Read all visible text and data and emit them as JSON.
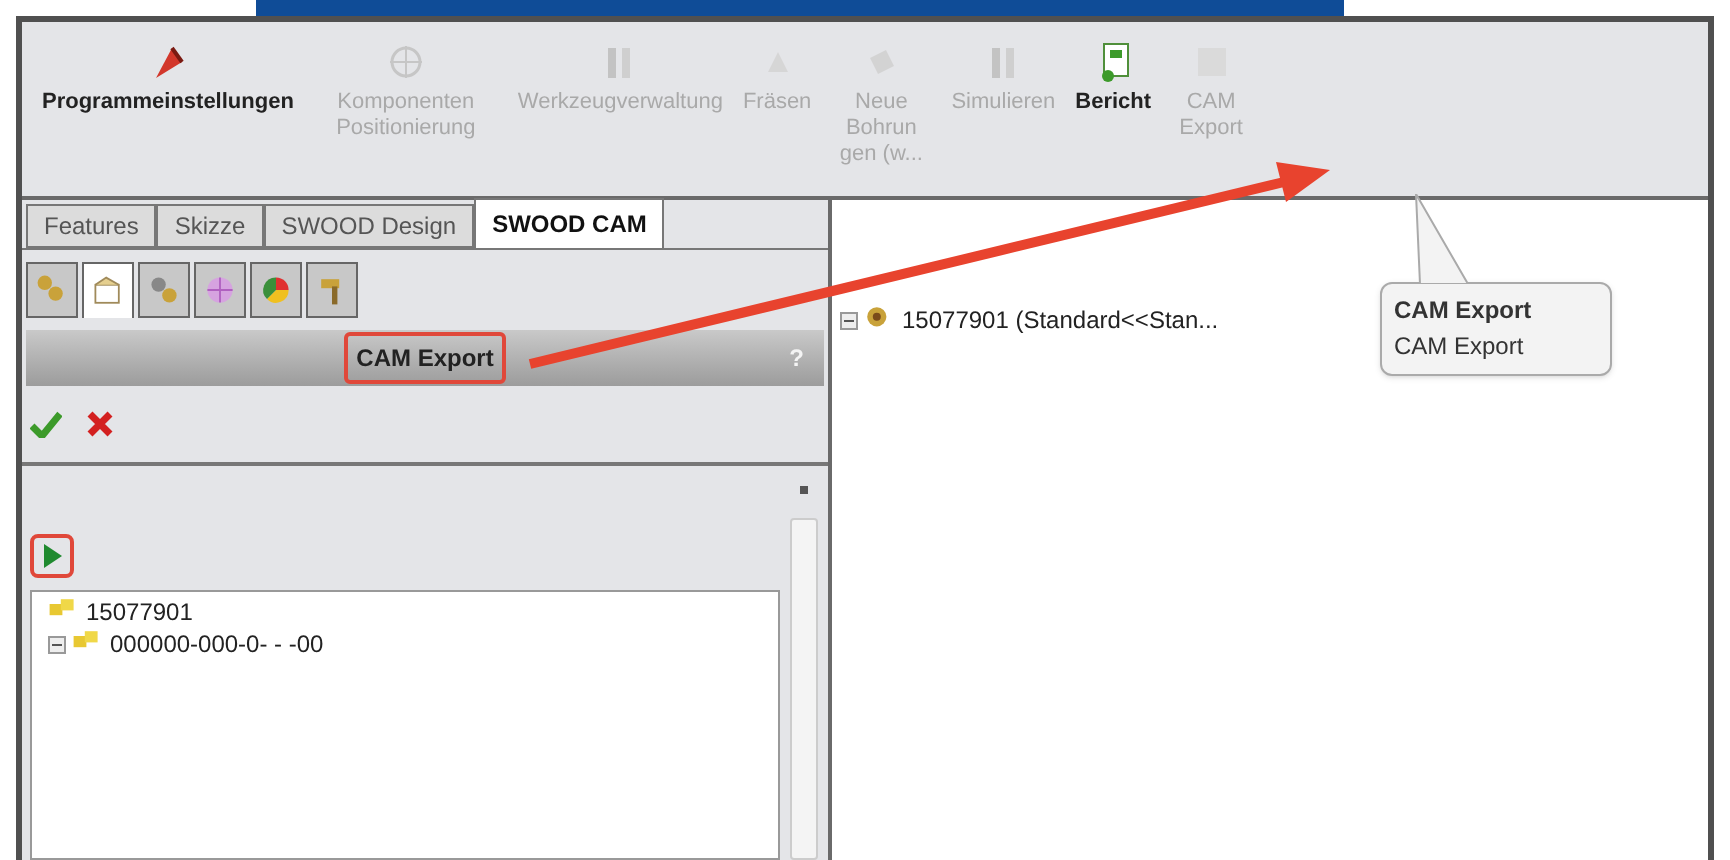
{
  "toolbar": {
    "buttons": [
      {
        "label": "Programmeinstellungen",
        "disabled": false
      },
      {
        "label": "Komponenten Positionierung",
        "disabled": true
      },
      {
        "label": "Werkzeugverwaltung",
        "disabled": true
      },
      {
        "label": "Fräsen",
        "disabled": true
      },
      {
        "label": "Neue Bohrun gen (w...",
        "disabled": true
      },
      {
        "label": "Simulieren",
        "disabled": true
      },
      {
        "label": "Bericht",
        "disabled": false
      },
      {
        "label": "CAM Export",
        "disabled": true
      }
    ]
  },
  "tabs": [
    {
      "label": "Features",
      "selected": false
    },
    {
      "label": "Skizze",
      "selected": false
    },
    {
      "label": "SWOOD Design",
      "selected": false
    },
    {
      "label": "SWOOD CAM",
      "selected": true
    }
  ],
  "icon_tabs": [
    {
      "selected": false
    },
    {
      "selected": true
    },
    {
      "selected": false
    },
    {
      "selected": false
    },
    {
      "selected": false
    },
    {
      "selected": false
    }
  ],
  "panel": {
    "title": "CAM Export",
    "title_highlighted": true,
    "help": "?",
    "run_highlighted": true,
    "tree": [
      {
        "label": "15077901",
        "children": [
          {
            "label": "000000-000-0- - -00",
            "expandable": true
          }
        ]
      }
    ]
  },
  "feature_tree": [
    {
      "label": "15077901 (Standard<<Stan...",
      "expandable": true
    }
  ],
  "tooltip": {
    "title": "CAM Export",
    "text": "CAM Export"
  },
  "annotations": [
    {
      "kind": "arrow"
    }
  ]
}
